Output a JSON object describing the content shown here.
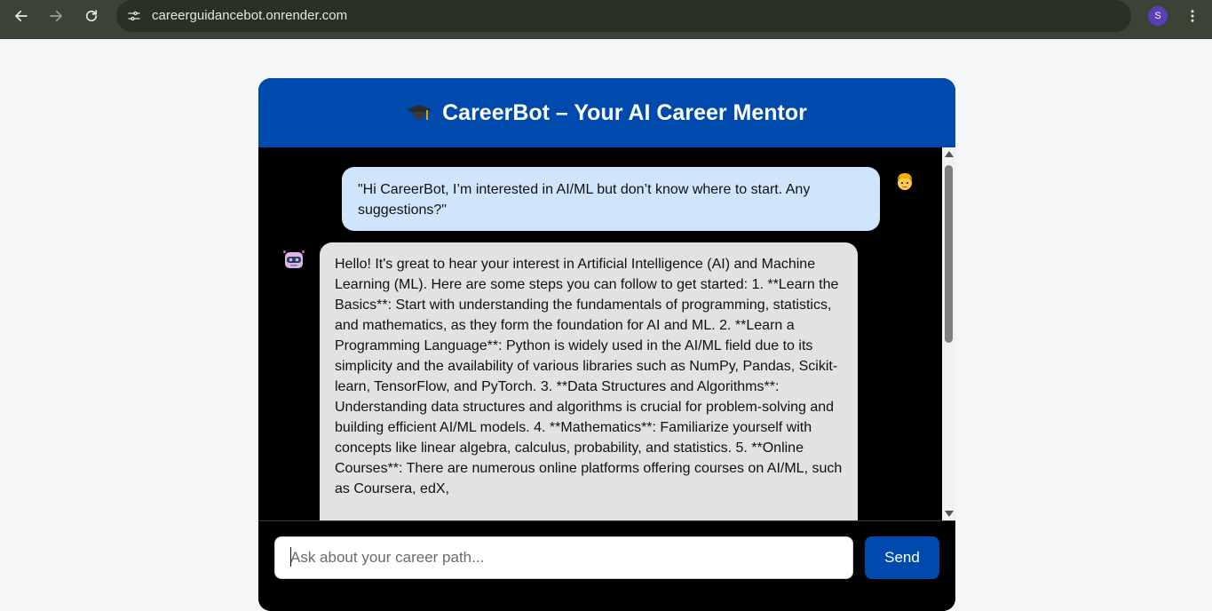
{
  "browser": {
    "url": "careerguidancebot.onrender.com",
    "profile_initial": "S",
    "icons": {
      "back": "back-arrow-icon",
      "forward": "forward-arrow-icon",
      "reload": "reload-icon",
      "site_info": "site-info-icon",
      "bookmark": "star-icon",
      "menu": "more-vertical-icon"
    }
  },
  "chat": {
    "title": "CareerBot – Your AI Career Mentor",
    "title_icon": "graduation-cap-icon",
    "messages": [
      {
        "role": "user",
        "avatar": "user-face-emoji-icon",
        "text": "\"Hi CareerBot, I’m interested in AI/ML but don’t know where to start. Any suggestions?\""
      },
      {
        "role": "bot",
        "avatar": "robot-face-icon",
        "text": "Hello! It's great to hear your interest in Artificial Intelligence (AI) and Machine Learning (ML). Here are some steps you can follow to get started: 1. **Learn the Basics**: Start with understanding the fundamentals of programming, statistics, and mathematics, as they form the foundation for AI and ML. 2. **Learn a Programming Language**: Python is widely used in the AI/ML field due to its simplicity and the availability of various libraries such as NumPy, Pandas, Scikit-learn, TensorFlow, and PyTorch. 3. **Data Structures and Algorithms**: Understanding data structures and algorithms is crucial for problem-solving and building efficient AI/ML models. 4. **Mathematics**: Familiarize yourself with concepts like linear algebra, calculus, probability, and statistics. 5. **Online Courses**: There are numerous online platforms offering courses on AI/ML, such as Coursera, edX,"
      }
    ],
    "input_placeholder": "Ask about your career path...",
    "input_value": "",
    "send_label": "Send"
  },
  "colors": {
    "header_bg": "#004aad",
    "user_bubble": "#cfe5fc",
    "bot_bubble": "#e2e2e2",
    "chat_bg": "#000000",
    "send_button": "#004aad"
  }
}
